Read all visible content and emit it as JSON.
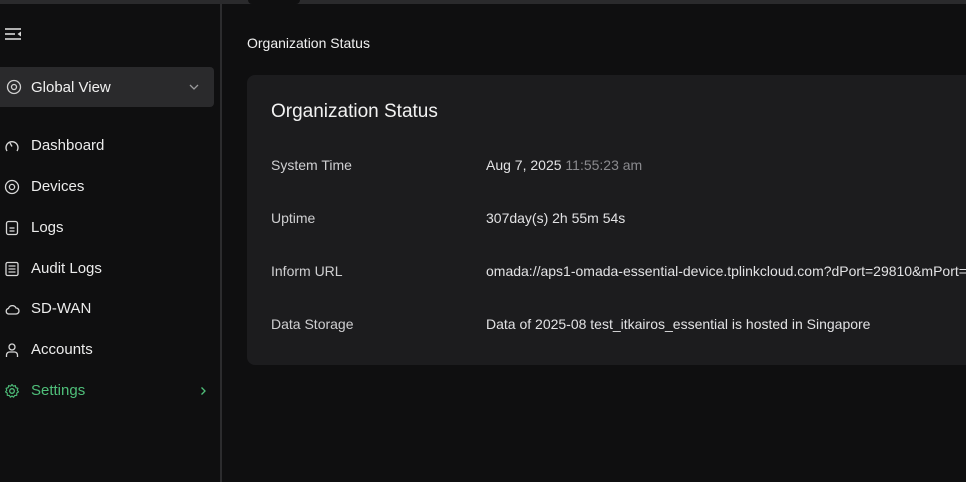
{
  "sidebar": {
    "site_selector": {
      "label": "Global View"
    },
    "items": [
      {
        "label": "Dashboard",
        "icon": "gauge-icon"
      },
      {
        "label": "Devices",
        "icon": "devices-icon"
      },
      {
        "label": "Logs",
        "icon": "logs-icon"
      },
      {
        "label": "Audit Logs",
        "icon": "audit-logs-icon"
      },
      {
        "label": "SD-WAN",
        "icon": "cloud-icon"
      },
      {
        "label": "Accounts",
        "icon": "user-icon"
      },
      {
        "label": "Settings",
        "icon": "gear-icon",
        "active": true
      }
    ]
  },
  "main": {
    "page_title": "Organization Status",
    "card": {
      "title": "Organization Status",
      "rows": [
        {
          "label": "System Time",
          "value_date": "Aug 7, 2025",
          "value_time": "11:55:23 am"
        },
        {
          "label": "Uptime",
          "value": "307day(s) 2h 55m 54s"
        },
        {
          "label": "Inform URL",
          "value": "omada://aps1-omada-essential-device.tplinkcloud.com?dPort=29810&mPort="
        },
        {
          "label": "Data Storage",
          "value": "Data of 2025-08 test_itkairos_essential is hosted in Singapore"
        }
      ]
    }
  },
  "colors": {
    "background": "#0f0f10",
    "card": "#1c1c1e",
    "accent_green": "#4fbf7a",
    "selector_bg": "#2a2a2c"
  }
}
